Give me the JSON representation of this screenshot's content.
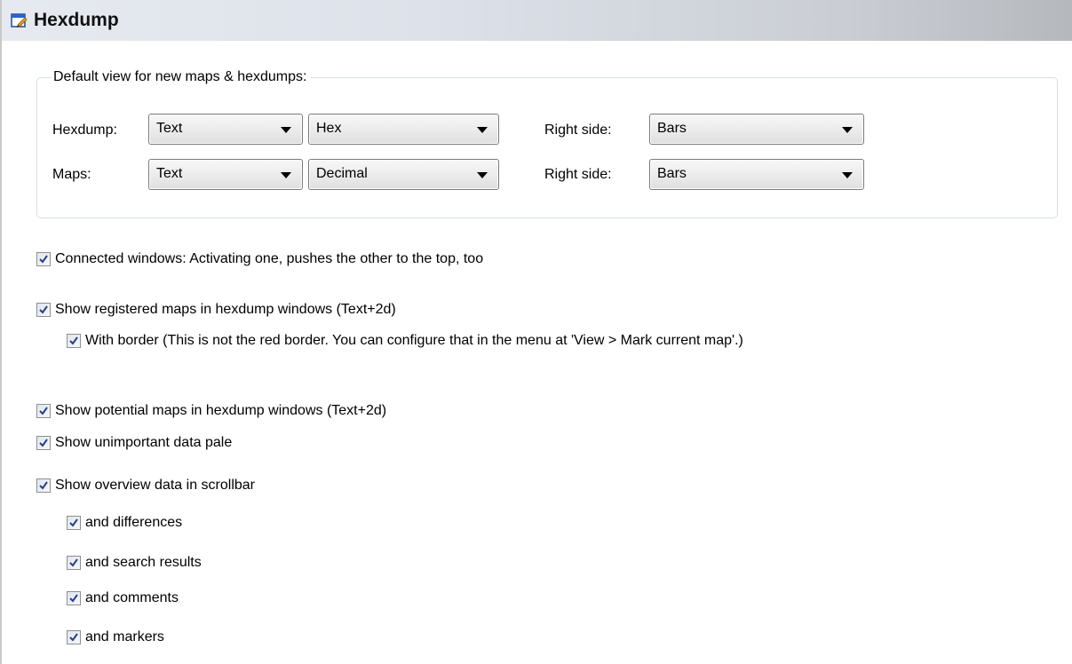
{
  "header": {
    "title": "Hexdump",
    "icon": "window-edit-icon"
  },
  "default_view": {
    "legend": "Default view for new maps & hexdumps:",
    "hexdump": {
      "label": "Hexdump:",
      "combo1": "Text",
      "combo2": "Hex",
      "right_label": "Right side:",
      "right_combo": "Bars"
    },
    "maps": {
      "label": "Maps:",
      "combo1": "Text",
      "combo2": "Decimal",
      "right_label": "Right side:",
      "right_combo": "Bars"
    }
  },
  "options": [
    {
      "label": "Connected windows: Activating one, pushes the other to the top, too",
      "checked": true
    },
    {
      "label": "Show registered maps in hexdump windows (Text+2d)",
      "checked": true
    },
    {
      "label": "With border (This is not the red border. You can configure that in the menu at 'View > Mark current map'.)",
      "checked": true
    },
    {
      "label": "Show potential maps in hexdump windows (Text+2d)",
      "checked": true
    },
    {
      "label": "Show unimportant data pale",
      "checked": true
    },
    {
      "label": "Show overview data in scrollbar",
      "checked": true
    },
    {
      "label": "and differences",
      "checked": true
    },
    {
      "label": "and search results",
      "checked": true
    },
    {
      "label": "and comments",
      "checked": true
    },
    {
      "label": "and markers",
      "checked": true
    }
  ],
  "colors": {
    "checkmark": "#2a3c8c",
    "header_gradient_start": "#e6eaf0",
    "header_gradient_end": "#b5b8bd"
  }
}
